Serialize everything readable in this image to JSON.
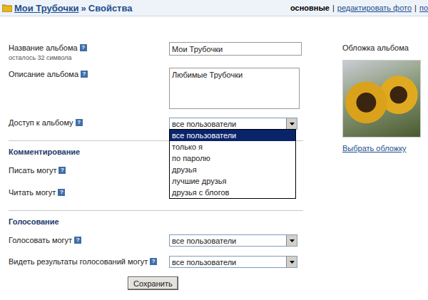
{
  "breadcrumb": {
    "album": "Мои Трубочки",
    "separator": "»",
    "page": "Свойства"
  },
  "nav": {
    "separator": "|",
    "items": [
      {
        "label": "основные",
        "selected": true
      },
      {
        "label": "редактировать фото",
        "selected": false
      },
      {
        "label": "по",
        "selected": false
      }
    ]
  },
  "help_icon": "?",
  "form": {
    "name": {
      "label": "Название альбома",
      "hint": "осталось 32 символа",
      "value": "Мои Трубочки"
    },
    "description": {
      "label": "Описание альбома",
      "value": "Любимые Трубочки"
    },
    "access": {
      "label": "Доступ к альбому",
      "value": "все пользователи",
      "expanded": true,
      "options": [
        {
          "label": "все пользователи",
          "selected": true
        },
        {
          "label": "только я",
          "selected": false
        },
        {
          "label": "по паролю",
          "selected": false
        },
        {
          "label": "друзья",
          "selected": false
        },
        {
          "label": "лучшие друзья",
          "selected": false
        },
        {
          "label": "друзья с блогов",
          "selected": false
        }
      ]
    }
  },
  "sections": [
    {
      "title": "Комментирование",
      "rows": [
        {
          "label": "Писать могут"
        },
        {
          "label": "Читать могут"
        }
      ]
    },
    {
      "title": "Голосование",
      "rows": [
        {
          "label": "Голосовать могут",
          "value": "все пользователи"
        },
        {
          "label": "Видеть результаты голосований могут",
          "value": "все пользователи"
        }
      ]
    }
  ],
  "cover": {
    "title": "Обложка альбома",
    "link": "Выбрать обложку"
  },
  "save_button": "Сохранить"
}
